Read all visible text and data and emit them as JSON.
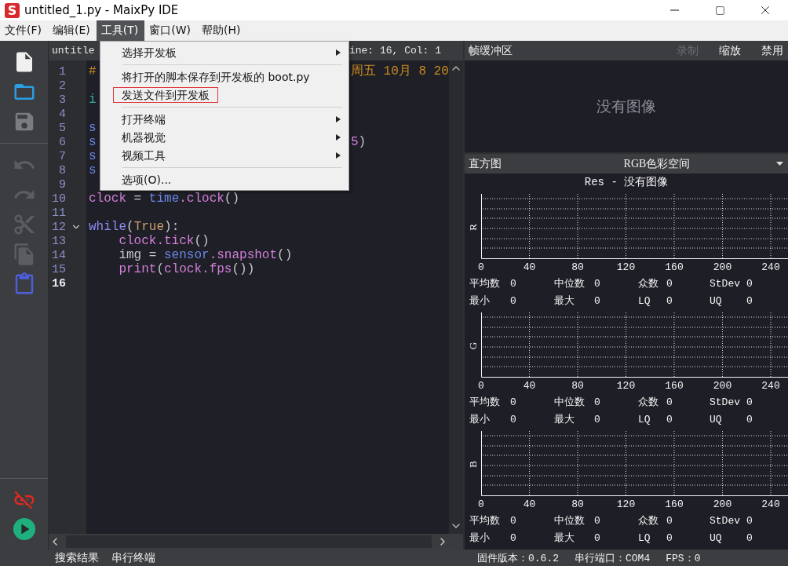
{
  "window": {
    "logo_letter": "S",
    "title": "untitled_1.py - MaixPy IDE"
  },
  "menubar": [
    {
      "label": "文件(F)",
      "selected": false
    },
    {
      "label": "编辑(E)",
      "selected": false
    },
    {
      "label": "工具(T)",
      "selected": true
    },
    {
      "label": "窗口(W)",
      "selected": false
    },
    {
      "label": "帮助(H)",
      "selected": false
    }
  ],
  "open_menu": {
    "items": [
      {
        "kind": "item",
        "label": "选择开发板",
        "submenu": true,
        "highlighted": false
      },
      {
        "kind": "separator"
      },
      {
        "kind": "item",
        "label": "将打开的脚本保存到开发板的 boot.py",
        "submenu": false,
        "highlighted": false
      },
      {
        "kind": "item",
        "label": "发送文件到开发板",
        "submenu": false,
        "highlighted": true
      },
      {
        "kind": "separator"
      },
      {
        "kind": "item",
        "label": "打开终端",
        "submenu": true,
        "highlighted": false
      },
      {
        "kind": "item",
        "label": "机器视觉",
        "submenu": true,
        "highlighted": false
      },
      {
        "kind": "item",
        "label": "视频工具",
        "submenu": true,
        "highlighted": false
      },
      {
        "kind": "separator"
      },
      {
        "kind": "item",
        "label": "选项(O)...",
        "submenu": false,
        "highlighted": false
      }
    ]
  },
  "toolbar": {
    "file_tools": [
      {
        "kind": "new",
        "disabled": false
      },
      {
        "kind": "open",
        "disabled": false
      },
      {
        "kind": "save",
        "disabled": true
      }
    ],
    "edit_tools": [
      {
        "kind": "undo",
        "disabled": true
      },
      {
        "kind": "redo",
        "disabled": true
      },
      {
        "kind": "cut",
        "disabled": true
      },
      {
        "kind": "copy",
        "disabled": true
      },
      {
        "kind": "paste",
        "disabled": false
      }
    ],
    "device_tools": [
      {
        "kind": "disconnect",
        "disabled": false
      },
      {
        "kind": "run",
        "disabled": false
      }
    ]
  },
  "editor": {
    "tab_left": "untitle",
    "tab_right": "ine: 16, Col: 1",
    "lines": [
      {
        "number": "1",
        "current": false,
        "fold": false,
        "segments": [
          {
            "kind": "comment",
            "text": "#"
          }
        ],
        "after_menu": [
          {
            "kind": "comment",
            "text": "周五 10月 8 20"
          }
        ]
      },
      {
        "number": "2",
        "current": false,
        "fold": false
      },
      {
        "number": "3",
        "current": false,
        "fold": false,
        "segments": [
          {
            "kind": "import",
            "text": "i"
          }
        ]
      },
      {
        "number": "4",
        "current": false,
        "fold": false
      },
      {
        "number": "5",
        "current": false,
        "fold": false,
        "segments": [
          {
            "kind": "module",
            "text": "s"
          }
        ]
      },
      {
        "number": "6",
        "current": false,
        "fold": false,
        "segments": [
          {
            "kind": "module",
            "text": "s"
          }
        ],
        "after_menu": [
          {
            "kind": "call",
            "text": "5"
          },
          {
            "kind": "plain",
            "text": ")"
          }
        ]
      },
      {
        "number": "7",
        "current": false,
        "fold": false,
        "segments": [
          {
            "kind": "module",
            "text": "s"
          }
        ]
      },
      {
        "number": "8",
        "current": false,
        "fold": false,
        "segments": [
          {
            "kind": "module",
            "text": "s"
          }
        ]
      },
      {
        "number": "9",
        "current": false,
        "fold": false
      },
      {
        "number": "10",
        "current": false,
        "fold": false,
        "segments": [
          {
            "kind": "call",
            "text": "clock"
          },
          {
            "kind": "plain",
            "text": " = "
          },
          {
            "kind": "module",
            "text": "time"
          },
          {
            "kind": "call",
            "text": ".clock"
          },
          {
            "kind": "plain",
            "text": "()"
          }
        ]
      },
      {
        "number": "11",
        "current": false,
        "fold": false
      },
      {
        "number": "12",
        "current": false,
        "fold": true,
        "segments": [
          {
            "kind": "keyword",
            "text": "while"
          },
          {
            "kind": "plain",
            "text": "("
          },
          {
            "kind": "constant",
            "text": "True"
          },
          {
            "kind": "plain",
            "text": "):"
          }
        ]
      },
      {
        "number": "13",
        "current": false,
        "fold": false,
        "indented": true,
        "segments": [
          {
            "kind": "call",
            "text": "clock.tick"
          },
          {
            "kind": "plain",
            "text": "()"
          }
        ]
      },
      {
        "number": "14",
        "current": false,
        "fold": false,
        "indented": true,
        "segments": [
          {
            "kind": "plain",
            "text": "img = "
          },
          {
            "kind": "module",
            "text": "sensor"
          },
          {
            "kind": "call",
            "text": ".snapshot"
          },
          {
            "kind": "plain",
            "text": "()"
          }
        ]
      },
      {
        "number": "15",
        "current": false,
        "fold": false,
        "indented": true,
        "segments": [
          {
            "kind": "call",
            "text": "print"
          },
          {
            "kind": "plain",
            "text": "("
          },
          {
            "kind": "call",
            "text": "clock.fps"
          },
          {
            "kind": "plain",
            "text": "())"
          }
        ]
      },
      {
        "number": "16",
        "current": true,
        "fold": false
      }
    ]
  },
  "framebuffer": {
    "title": "帧缓冲区",
    "buttons": [
      {
        "label": "录制",
        "disabled": true
      },
      {
        "label": "缩放",
        "disabled": false
      },
      {
        "label": "禁用",
        "disabled": false
      }
    ],
    "empty_text": "没有图像"
  },
  "histogram": {
    "title": "直方图",
    "color_space": "RGB色彩空间",
    "chart_title": "Res - 没有图像",
    "channels": [
      {
        "axis_label": "R",
        "xticks": [
          "0",
          "40",
          "80",
          "120",
          "160",
          "200",
          "240"
        ],
        "stats": [
          [
            {
              "label": "平均数",
              "value": "0"
            },
            {
              "label": "中位数",
              "value": "0"
            },
            {
              "label": "众数",
              "value": "0"
            },
            {
              "label": "StDev",
              "value": "0"
            }
          ],
          [
            {
              "label": "最小",
              "value": "0"
            },
            {
              "label": "最大",
              "value": "0"
            },
            {
              "label": "LQ",
              "value": "0"
            },
            {
              "label": "UQ",
              "value": "0"
            }
          ]
        ]
      },
      {
        "axis_label": "G",
        "xticks": [
          "0",
          "40",
          "80",
          "120",
          "160",
          "200",
          "240"
        ],
        "stats": [
          [
            {
              "label": "平均数",
              "value": "0"
            },
            {
              "label": "中位数",
              "value": "0"
            },
            {
              "label": "众数",
              "value": "0"
            },
            {
              "label": "StDev",
              "value": "0"
            }
          ],
          [
            {
              "label": "最小",
              "value": "0"
            },
            {
              "label": "最大",
              "value": "0"
            },
            {
              "label": "LQ",
              "value": "0"
            },
            {
              "label": "UQ",
              "value": "0"
            }
          ]
        ]
      },
      {
        "axis_label": "B",
        "xticks": [
          "0",
          "40",
          "80",
          "120",
          "160",
          "200",
          "240"
        ],
        "stats": [
          [
            {
              "label": "平均数",
              "value": "0"
            },
            {
              "label": "中位数",
              "value": "0"
            },
            {
              "label": "众数",
              "value": "0"
            },
            {
              "label": "StDev",
              "value": "0"
            }
          ],
          [
            {
              "label": "最小",
              "value": "0"
            },
            {
              "label": "最大",
              "value": "0"
            },
            {
              "label": "LQ",
              "value": "0"
            },
            {
              "label": "UQ",
              "value": "0"
            }
          ]
        ]
      }
    ]
  },
  "status_bar": {
    "tabs": [
      "搜索结果",
      "串行终端"
    ],
    "firmware": "固件版本：0.6.2",
    "port": "串行端口：COM4",
    "fps": "FPS：0"
  }
}
